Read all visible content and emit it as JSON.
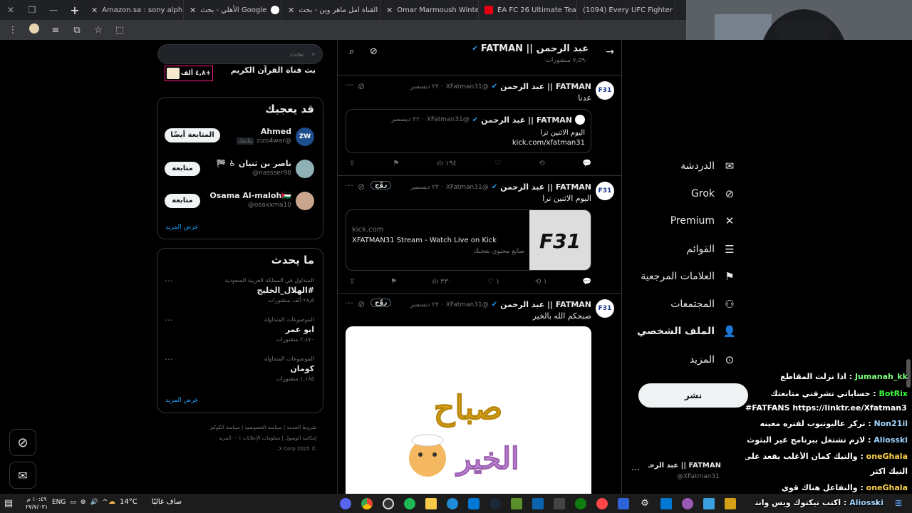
{
  "browser": {
    "tabs": [
      {
        "label": "Amazon.sa : sony alpha",
        "fav": "#ff9900"
      },
      {
        "label": "الأهلي - بحث Google",
        "fav": "#4285f4"
      },
      {
        "label": "القناة امل ماهر وين - بحث",
        "fav": "#4285f4"
      },
      {
        "label": "Omar Marmoush Winter",
        "fav": "#4285f4"
      },
      {
        "label": "EA FC 26 Ultimate Team",
        "fav": "#e60012"
      },
      {
        "label": "(1094) Every UFC Fighter",
        "fav": "#ff0000"
      }
    ]
  },
  "header": {
    "name": "FATMAN || عبد الرحمن",
    "posts": "٧,٥٩٠ منشورات"
  },
  "search": {
    "placeholder": "بحث"
  },
  "top_partial": {
    "text": "بث قناة القرآن الكريم",
    "count": "٤,٨ ألف+"
  },
  "who_to_follow": {
    "title": "قد يعجبك",
    "items": [
      {
        "name": "Ahmed",
        "handle": "@zizo4war",
        "tag": "يتابعك",
        "button": "المتابعة أيضًا",
        "avatar": "ZW"
      },
      {
        "name": "ناصر بن ثنيان ♿ 🏁",
        "handle": "@nassser98",
        "button": "متابعة",
        "avatar": ""
      },
      {
        "name": "Osama Al-maloh🇵🇸",
        "handle": "@osaxxma10",
        "button": "متابعة",
        "avatar": ""
      }
    ],
    "more": "عرض المزيد"
  },
  "trends": {
    "title": "ما يحدث",
    "items": [
      {
        "context": "المتداول في المملكة العربية السعودية",
        "name": "#الهلال_الخليج",
        "count": "٢٨٫٥ ألف منشورات"
      },
      {
        "context": "الموضوعات المتداولة",
        "name": "ابو عمر",
        "count": "٢,٤٧٠ منشورات"
      },
      {
        "context": "الموضوعات المتداولة",
        "name": "كومان",
        "count": "١,١٨٥ منشورات"
      }
    ],
    "more": "عرض المزيد"
  },
  "footer": {
    "links": [
      "شروط الخدمة",
      "سياسة الخصوصية",
      "سياسة الكوكيز",
      "إمكانية الوصول",
      "معلومات الإعلانات",
      "··· المزيد"
    ],
    "copyright": "© 2025 X Corp."
  },
  "tweets": [
    {
      "name": "FATMAN || عبد الرحمن",
      "handle": "@XFatman31",
      "date": "· ٢٢ ديسمبر",
      "text": "عدنا",
      "quote": {
        "name": "FATMAN || عبد الرحمن",
        "handle": "@XFatman31",
        "date": "· ٢٢ ديسمبر",
        "line1": "اليوم الاثنين ترا",
        "line2": "kick.com/xfatman31"
      },
      "views": "١٩٤"
    },
    {
      "name": "FATMAN || عبد الرحمن",
      "handle": "@XFatman31",
      "date": "· ٢٢ ديسمبر",
      "badge": "روِّج",
      "text": "اليوم الاثنين ترا",
      "card": {
        "domain": "kick.com",
        "title": "XFATMAN31 Stream - Watch Live on Kick",
        "sub": "صانع محتوى بعجبك",
        "logo": "F31"
      },
      "views": "٣٣٠",
      "likes": "١",
      "reposts": "١"
    },
    {
      "name": "FATMAN || عبد الرحمن",
      "handle": "@XFatman31",
      "date": "· ٢٢ ديسمبر",
      "badge": "روِّج",
      "text": "صبحكم الله بالخير",
      "image_text": "صباح الخير"
    }
  ],
  "nav": [
    {
      "label": "الدردشة",
      "icon": "mail-icon",
      "glyph": "✉"
    },
    {
      "label": "Grok",
      "icon": "grok-icon",
      "glyph": "⊘"
    },
    {
      "label": "Premium",
      "icon": "x-logo-icon",
      "glyph": "✕"
    },
    {
      "label": "القوائم",
      "icon": "list-icon",
      "glyph": "☰"
    },
    {
      "label": "العلامات المرجعية",
      "icon": "bookmark-icon",
      "glyph": "⚑"
    },
    {
      "label": "المجتمعات",
      "icon": "communities-icon",
      "glyph": "👥"
    },
    {
      "label": "الملف الشخصي",
      "icon": "profile-icon",
      "glyph": "👤"
    },
    {
      "label": "المزيد",
      "icon": "more-icon",
      "glyph": "⋯"
    }
  ],
  "post_button": "نشر",
  "account": {
    "name": "FATMAN || عبد الرحمن ...",
    "handle": "@XFatman31"
  },
  "chat": [
    {
      "user": "Jumanah_kk",
      "msg": "اذا نزلت المقاطع",
      "color": "#7fff7f"
    },
    {
      "user": "BotRix",
      "msg": "حساباتي تشرفني متابعتك",
      "color": "#3cff3c"
    },
    {
      "user": "",
      "msg": "#FATFANS https://linktr.ee/Xfatman31",
      "color": "#fff"
    },
    {
      "user": "Non21il",
      "msg": "تركز عاليوتيوب لفتره معينه",
      "color": "#9fd4ff"
    },
    {
      "user": "Aliosski",
      "msg": "لازم تشتغل ببرنامج غير البثوث",
      "color": "#9fd4ff"
    },
    {
      "user": "oneGhala",
      "msg": "والتيك كمان الأغلب يقعد على",
      "color": "#ffd54a"
    },
    {
      "user": "",
      "msg": "التيك اكثر",
      "color": "#fff"
    },
    {
      "user": "oneGhala",
      "msg": "والتفاعل هناك قوي",
      "color": "#ffd54a"
    },
    {
      "user": "Aliosski",
      "msg": "اكتب تيكتوك ويس وانته",
      "color": "#9fd4ff"
    }
  ],
  "taskbar": {
    "weather": "14°C",
    "weather_desc": "صاف غالبًا",
    "lang": "ENG",
    "time": "١٠:٤٩ م",
    "date": "٢٧/٧/٠٢١"
  },
  "left_floating": {
    "grok": "grok-icon",
    "messages": "messages-icon"
  }
}
